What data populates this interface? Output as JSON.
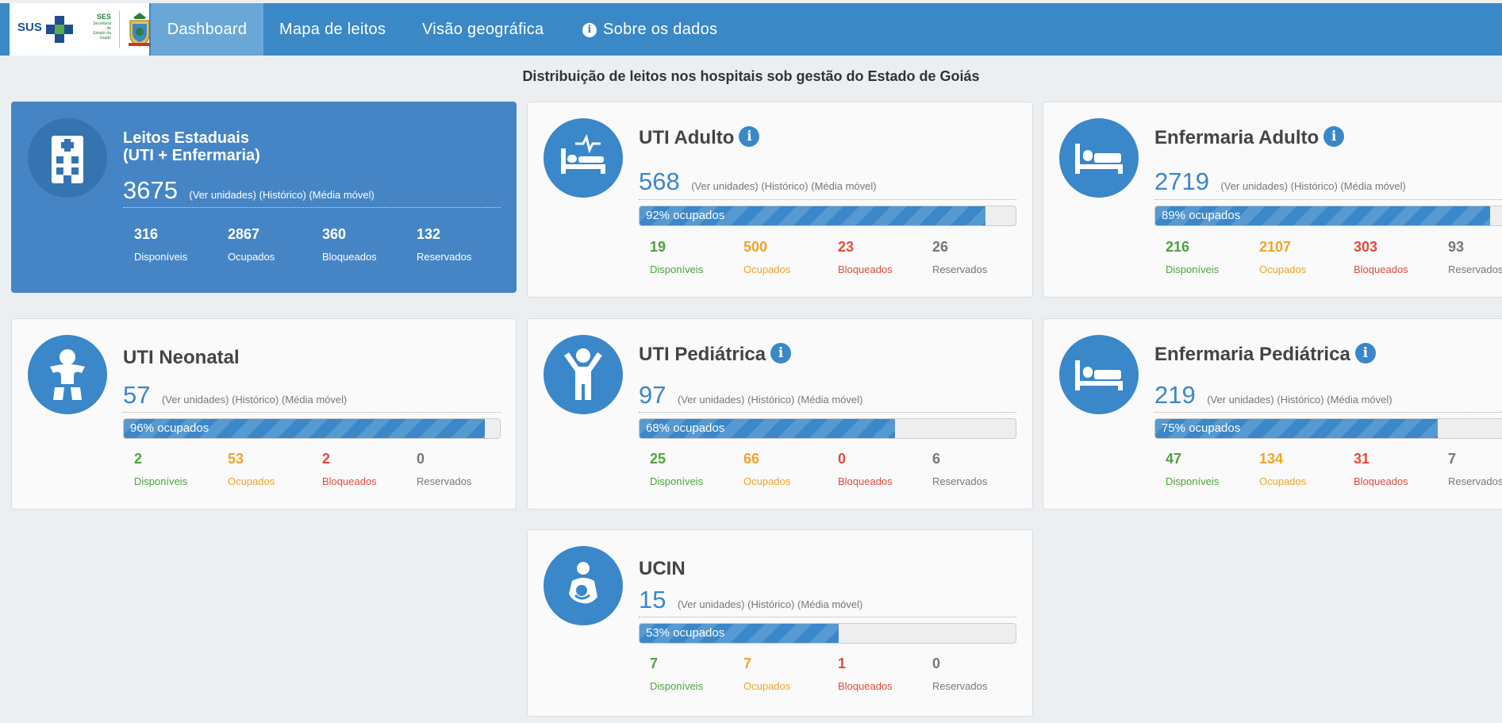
{
  "nav": {
    "logo_text": "SUS",
    "ses_logo": [
      "SES",
      "Secretaria de",
      "Estado da",
      "Saúde"
    ],
    "items": [
      {
        "label": "Dashboard"
      },
      {
        "label": "Mapa de leitos"
      },
      {
        "label": "Visão geográfica"
      },
      {
        "label": "Sobre os dados"
      }
    ]
  },
  "page_title": "Distribuição de leitos nos hospitais sob gestão do Estado de Goiás",
  "links": {
    "units": "(Ver unidades)",
    "history": "(Histórico)",
    "moving_avg": "(Média móvel)"
  },
  "labels": {
    "available": "Disponíveis",
    "occupied": "Ocupados",
    "blocked": "Bloqueados",
    "reserved": "Reservados"
  },
  "cards": {
    "estaduais": {
      "title_line1": "Leitos Estaduais",
      "title_line2": "(UTI + Enfermaria)",
      "total": "3675",
      "available": "316",
      "occupied": "2867",
      "blocked": "360",
      "reserved": "132",
      "icon": "hospital-icon"
    },
    "uti_adulto": {
      "title": "UTI Adulto",
      "total": "568",
      "occupancy_pct": 92,
      "occupancy_label": "92% ocupados",
      "available": "19",
      "occupied": "500",
      "blocked": "23",
      "reserved": "26",
      "icon": "icu-bed-icon"
    },
    "enf_adulto": {
      "title": "Enfermaria Adulto",
      "total": "2719",
      "occupancy_pct": 89,
      "occupancy_label": "89% ocupados",
      "available": "216",
      "occupied": "2107",
      "blocked": "303",
      "reserved": "93",
      "icon": "bed-icon"
    },
    "uti_neonatal": {
      "title": "UTI Neonatal",
      "total": "57",
      "occupancy_pct": 96,
      "occupancy_label": "96% ocupados",
      "available": "2",
      "occupied": "53",
      "blocked": "2",
      "reserved": "0",
      "icon": "baby-icon"
    },
    "uti_pediatrica": {
      "title": "UTI Pediátrica",
      "total": "97",
      "occupancy_pct": 68,
      "occupancy_label": "68% ocupados",
      "available": "25",
      "occupied": "66",
      "blocked": "0",
      "reserved": "6",
      "icon": "child-icon"
    },
    "enf_pediatrica": {
      "title": "Enfermaria Pediátrica",
      "total": "219",
      "occupancy_pct": 75,
      "occupancy_label": "75% ocupados",
      "available": "47",
      "occupied": "134",
      "blocked": "31",
      "reserved": "7",
      "icon": "bed-icon"
    },
    "ucin": {
      "title": "UCIN",
      "total": "15",
      "occupancy_pct": 53,
      "occupancy_label": "53% ocupados",
      "available": "7",
      "occupied": "7",
      "blocked": "1",
      "reserved": "0",
      "icon": "baby-care-icon"
    }
  },
  "colors": {
    "primary": "#3a87c9",
    "nav": "#3b88c6",
    "available": "#4ea23e",
    "occupied": "#f0a32e",
    "blocked": "#e04a3f",
    "reserved": "#777777"
  }
}
